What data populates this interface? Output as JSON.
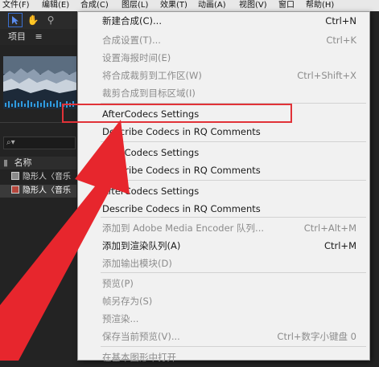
{
  "menubar": {
    "items": [
      "文件(F)",
      "编辑(E)",
      "合成(C)",
      "图层(L)",
      "效果(T)",
      "动画(A)",
      "视图(V)",
      "窗口",
      "帮助(H)"
    ]
  },
  "toolbar": {
    "tools": [
      "selection-arrow-icon",
      "hand-icon",
      "zoom-icon"
    ]
  },
  "project": {
    "title": "项目",
    "menu_icon": "≡",
    "search_icon": "⌕▾",
    "column_name": "名称",
    "rows": [
      "隐形人〈音乐",
      "隐形人〈音乐"
    ]
  },
  "menu": {
    "items": [
      {
        "label": "新建合成(C)...",
        "shortcut": "Ctrl+N",
        "disabled": false
      },
      {
        "label": "合成设置(T)...",
        "shortcut": "Ctrl+K",
        "disabled": true
      },
      {
        "label": "设置海报时间(E)",
        "shortcut": "",
        "disabled": true
      },
      {
        "label": "将合成裁剪到工作区(W)",
        "shortcut": "Ctrl+Shift+X",
        "disabled": true
      },
      {
        "label": "裁剪合成到目标区域(I)",
        "shortcut": "",
        "disabled": true
      },
      {
        "label": "AfterCodecs Settings",
        "shortcut": "",
        "disabled": false
      },
      {
        "label": "Describe Codecs in RQ Comments",
        "shortcut": "",
        "disabled": false
      },
      {
        "label": "AfterCodecs Settings",
        "shortcut": "",
        "disabled": false
      },
      {
        "label": "Describe Codecs in RQ Comments",
        "shortcut": "",
        "disabled": false
      },
      {
        "label": "AfterCodecs Settings",
        "shortcut": "",
        "disabled": false
      },
      {
        "label": "Describe Codecs in RQ Comments",
        "shortcut": "",
        "disabled": false
      },
      {
        "label": "添加到 Adobe Media Encoder 队列...",
        "shortcut": "Ctrl+Alt+M",
        "disabled": true
      },
      {
        "label": "添加到渲染队列(A)",
        "shortcut": "Ctrl+M",
        "disabled": false
      },
      {
        "label": "添加输出模块(D)",
        "shortcut": "",
        "disabled": true
      },
      {
        "label": "预览(P)",
        "shortcut": "",
        "disabled": true
      },
      {
        "label": "帧另存为(S)",
        "shortcut": "",
        "disabled": true
      },
      {
        "label": "预渲染...",
        "shortcut": "",
        "disabled": true
      },
      {
        "label": "保存当前预览(V)...",
        "shortcut": "Ctrl+数字小键盘 0",
        "disabled": true
      },
      {
        "label": "在基本图形中打开",
        "shortcut": "",
        "disabled": true
      }
    ]
  },
  "colors": {
    "highlight_box": "#e13238",
    "arrow": "#e7262d",
    "menu_bg": "#f1f1f1",
    "panel_bg": "#232323"
  }
}
